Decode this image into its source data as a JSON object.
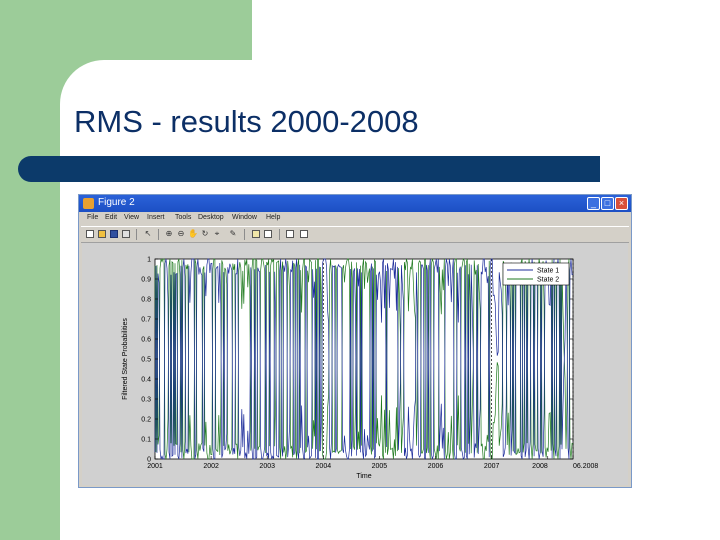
{
  "slide": {
    "title": "RMS - results 2000-2008"
  },
  "window": {
    "title": "Figure 2",
    "buttons": {
      "minimize": "_",
      "maximize": "□",
      "close": "×"
    }
  },
  "menu": {
    "items": [
      "File",
      "Edit",
      "View",
      "Insert",
      "Tools",
      "Desktop",
      "Window",
      "Help"
    ]
  },
  "toolbar": {
    "tools": [
      "new-icon",
      "open-icon",
      "save-icon",
      "print-icon",
      "arrow-icon",
      "zoom-in-icon",
      "zoom-out-icon",
      "pan-icon",
      "rotate-icon",
      "datacursor-icon",
      "brush-icon",
      "colorbar-icon",
      "legend-icon",
      "hide-tools-icon",
      "show-tools-icon"
    ]
  },
  "colors": {
    "state1": "#1c2c9a",
    "state2": "#1f7a1f",
    "window_caption": "#2b62d8",
    "title_bar": "#0c3a6a",
    "green": "#9ccc99"
  },
  "chart_data": {
    "type": "line",
    "ylabel": "Filtered State Probabilities",
    "xlabel": "Time",
    "ylim": [
      0,
      1
    ],
    "yticks": [
      "0",
      "0.1",
      "0.2",
      "0.3",
      "0.4",
      "0.5",
      "0.6",
      "0.7",
      "0.8",
      "0.9",
      "1"
    ],
    "xticks": [
      "2001",
      "2002",
      "2003",
      "2004",
      "2005",
      "2006",
      "2007",
      "2008",
      "06.2008"
    ],
    "xrange": [
      2001.0,
      2008.45
    ],
    "dashed_lines_x": [
      2004.0,
      2007.0,
      2008.45
    ],
    "legend": {
      "position": "top-right",
      "entries": [
        "State 1",
        "State 2"
      ]
    },
    "series": [
      {
        "name": "State 1",
        "color": "#1c2c9a"
      },
      {
        "name": "State 2",
        "color": "#1f7a1f"
      }
    ]
  }
}
